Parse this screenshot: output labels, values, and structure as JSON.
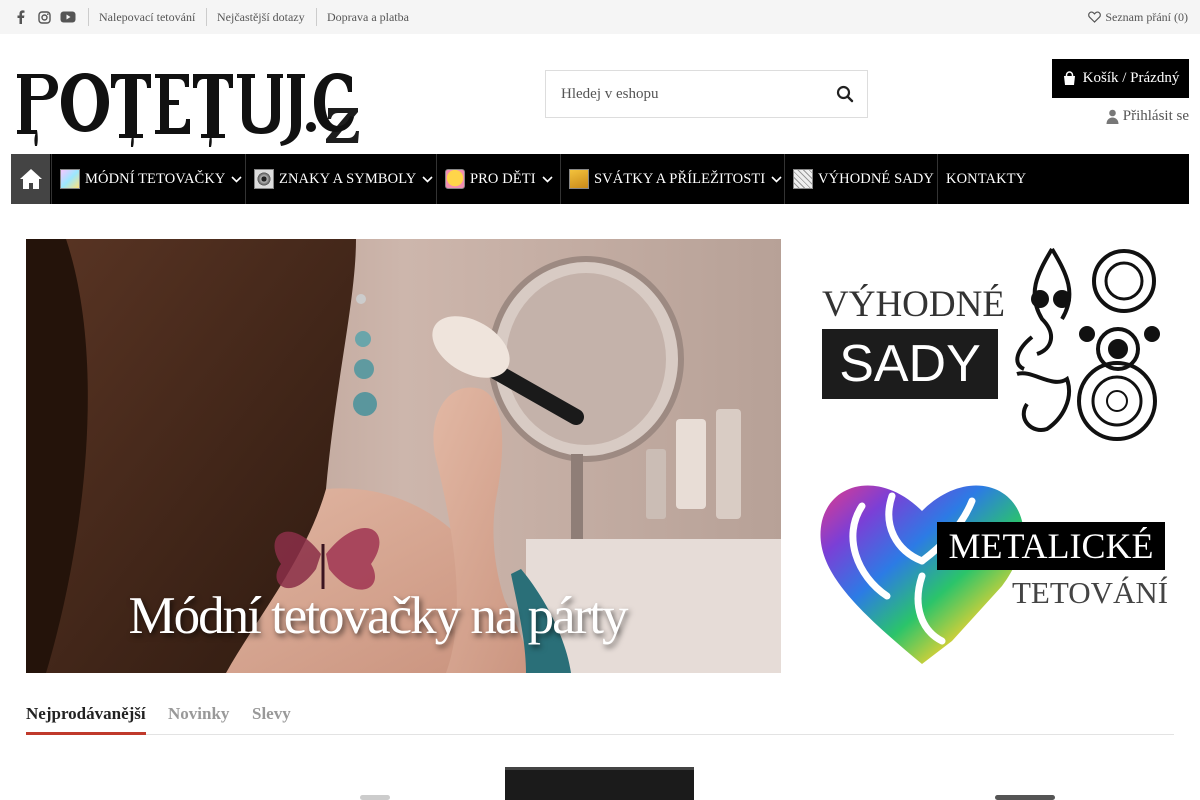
{
  "topbar": {
    "links": [
      "Nalepovací tetování",
      "Nejčastější dotazy",
      "Doprava a platba"
    ],
    "wishlist": "Seznam přání (0)"
  },
  "header": {
    "search_placeholder": "Hledej v eshopu",
    "cart": "Košík / Prázdný",
    "login": "Přihlásit se"
  },
  "nav": {
    "items": [
      {
        "label": "MÓDNÍ TETOVAČKY"
      },
      {
        "label": "ZNAKY A SYMBOLY"
      },
      {
        "label": "PRO DĚTI"
      },
      {
        "label": "SVÁTKY A PŘÍLEŽITOSTI"
      },
      {
        "label": "VÝHODNÉ SADY"
      },
      {
        "label": "KONTAKTY"
      }
    ]
  },
  "banners": {
    "hero_title": "Módní tetovačky na párty",
    "side1_line1": "VÝHODNÉ",
    "side1_line2": "SADY",
    "side2_line1": "METALICKÉ",
    "side2_line2": "TETOVÁNÍ"
  },
  "tabs": [
    "Nejprodávanější",
    "Novinky",
    "Slevy"
  ],
  "colors": {
    "topbar_bg": "#f5f5f5",
    "nav_bg": "#000000",
    "accent": "#c0392b"
  }
}
